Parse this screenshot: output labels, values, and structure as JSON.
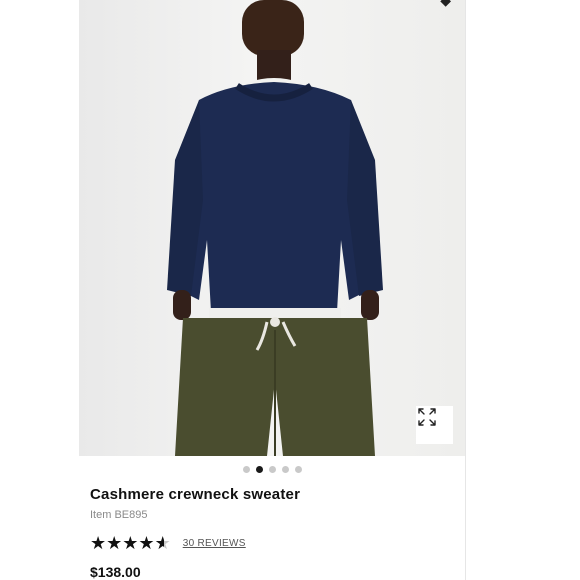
{
  "gallery": {
    "dot_count": 5,
    "active_index": 1,
    "expand_icon": "expand-arrows-icon"
  },
  "product": {
    "title": "Cashmere crewneck sweater",
    "item_number": "Item BE895",
    "rating": 4.5,
    "rating_max": 5,
    "reviews_label": "30 REVIEWS",
    "price": "$138.00"
  },
  "colors": {
    "sweater": "#1d2b52",
    "pants": "#4a4d2f",
    "active_dot": "#1a1a1a",
    "inactive_dot": "#c9c9c9"
  }
}
